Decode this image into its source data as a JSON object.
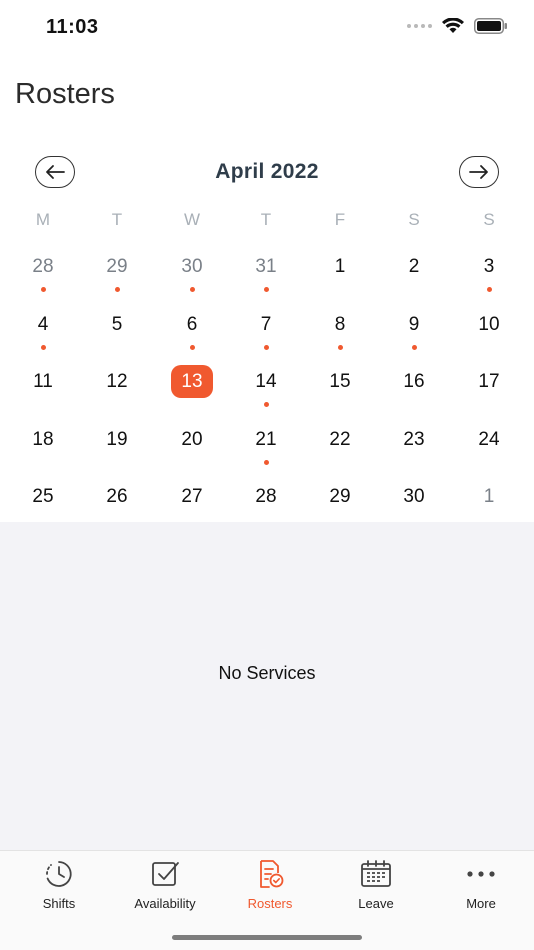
{
  "status": {
    "time": "11:03"
  },
  "page": {
    "title": "Rosters"
  },
  "calendar": {
    "month_label": "April 2022",
    "weekdays": [
      "M",
      "T",
      "W",
      "T",
      "F",
      "S",
      "S"
    ],
    "weeks": [
      [
        {
          "n": "28",
          "muted": true,
          "dot": true
        },
        {
          "n": "29",
          "muted": true,
          "dot": true
        },
        {
          "n": "30",
          "muted": true,
          "dot": true
        },
        {
          "n": "31",
          "muted": true,
          "dot": true
        },
        {
          "n": "1"
        },
        {
          "n": "2"
        },
        {
          "n": "3",
          "dot": true
        }
      ],
      [
        {
          "n": "4",
          "dot": true
        },
        {
          "n": "5"
        },
        {
          "n": "6",
          "dot": true
        },
        {
          "n": "7",
          "dot": true
        },
        {
          "n": "8",
          "dot": true
        },
        {
          "n": "9",
          "dot": true
        },
        {
          "n": "10"
        }
      ],
      [
        {
          "n": "11"
        },
        {
          "n": "12"
        },
        {
          "n": "13",
          "selected": true
        },
        {
          "n": "14",
          "dot": true
        },
        {
          "n": "15"
        },
        {
          "n": "16"
        },
        {
          "n": "17"
        }
      ],
      [
        {
          "n": "18"
        },
        {
          "n": "19"
        },
        {
          "n": "20"
        },
        {
          "n": "21",
          "dot": true
        },
        {
          "n": "22"
        },
        {
          "n": "23"
        },
        {
          "n": "24"
        }
      ],
      [
        {
          "n": "25"
        },
        {
          "n": "26"
        },
        {
          "n": "27"
        },
        {
          "n": "28"
        },
        {
          "n": "29"
        },
        {
          "n": "30"
        },
        {
          "n": "1",
          "muted": true
        }
      ]
    ]
  },
  "content": {
    "empty_text": "No Services"
  },
  "tabs": [
    {
      "label": "Shifts",
      "icon": "clock-history-icon",
      "active": false
    },
    {
      "label": "Availability",
      "icon": "checkbox-icon",
      "active": false
    },
    {
      "label": "Rosters",
      "icon": "roster-document-icon",
      "active": true
    },
    {
      "label": "Leave",
      "icon": "calendar-icon",
      "active": false
    },
    {
      "label": "More",
      "icon": "more-dots-icon",
      "active": false
    }
  ],
  "colors": {
    "accent": "#f0592f",
    "muted_text": "#7a8088",
    "weekday_text": "#a9b0b7",
    "content_bg": "#f3f3f7"
  }
}
